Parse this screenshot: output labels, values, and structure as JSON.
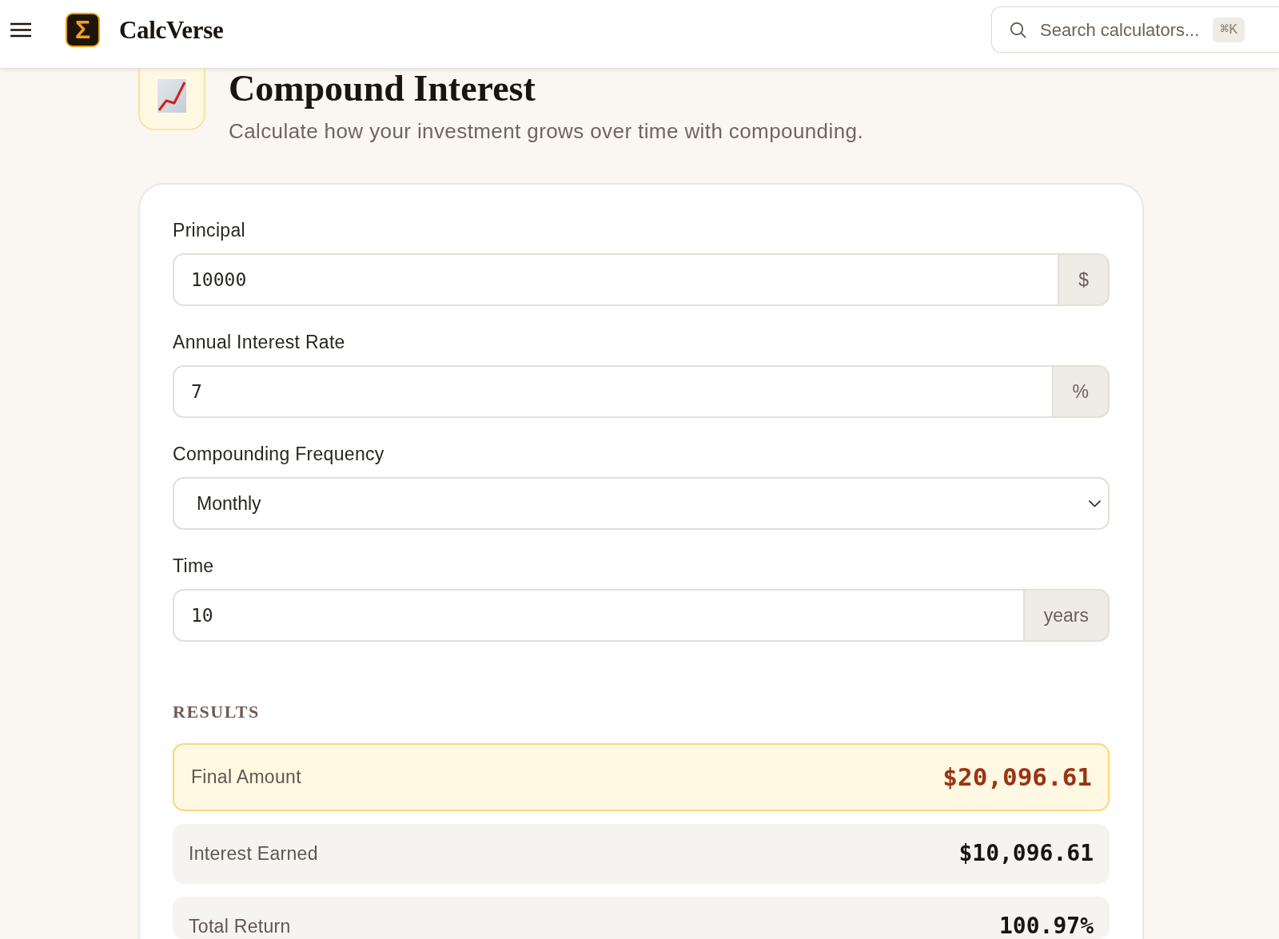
{
  "header": {
    "brand": {
      "glyph": "Σ",
      "name": "CalcVerse"
    },
    "search": {
      "placeholder": "Search calculators...",
      "shortcut": "⌘K"
    }
  },
  "page": {
    "title": "Compound Interest",
    "subtitle": "Calculate how your investment grows over time with compounding."
  },
  "form": {
    "fields": [
      {
        "kind": "number",
        "label": "Principal",
        "value": "10000",
        "unit": "$"
      },
      {
        "kind": "number",
        "label": "Annual Interest Rate",
        "value": "7",
        "unit": "%"
      },
      {
        "kind": "select",
        "label": "Compounding Frequency",
        "value": "Monthly"
      },
      {
        "kind": "number",
        "label": "Time",
        "value": "10",
        "unit": "years"
      }
    ]
  },
  "results": {
    "heading": "RESULTS",
    "items": [
      {
        "label": "Final Amount",
        "value": "$20,096.61",
        "highlighted": true
      },
      {
        "label": "Interest Earned",
        "value": "$10,096.61",
        "highlighted": false
      },
      {
        "label": "Total Return",
        "value": "100.97%",
        "highlighted": false
      }
    ]
  }
}
